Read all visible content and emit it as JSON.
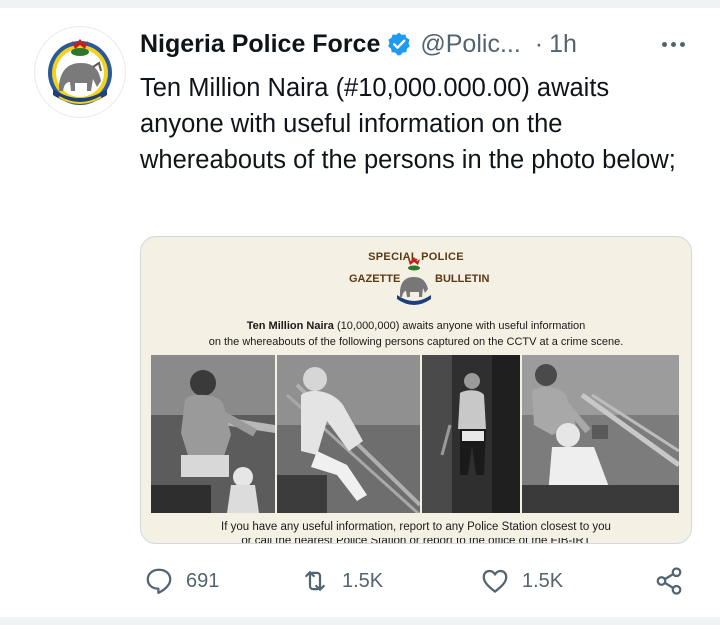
{
  "tweet": {
    "author_name": "Nigeria Police Force",
    "handle": "@Polic...",
    "separator": "·",
    "time": "1h",
    "text": "Ten Million Naira (#10,000.000.00) awaits anyone with useful information on the whereabouts of the persons in the photo below;"
  },
  "bulletin": {
    "title_line1": "SPECIAL POLICE",
    "title_left": "GAZETTE",
    "title_right": "BULLETIN",
    "body_bold": "Ten Million Naira",
    "body_rest": " (10,000,000) awaits anyone with useful information",
    "body_line2": "on the whereabouts of the following persons captured on the CCTV at a crime scene.",
    "footer": "If you have any useful information, report to any Police Station closest to you",
    "footer_cut": "or call the nearest Police Station or report to the office of the FIB-IRT"
  },
  "actions": {
    "replies": "691",
    "retweets": "1.5K",
    "likes": "1.5K"
  },
  "icons": [
    "verified-badge-icon",
    "more-options-icon",
    "reply-icon",
    "retweet-icon",
    "like-icon",
    "share-icon"
  ],
  "colors": {
    "verified": "#1d9bf0",
    "muted": "#536471",
    "divider": "#eff3f4"
  }
}
